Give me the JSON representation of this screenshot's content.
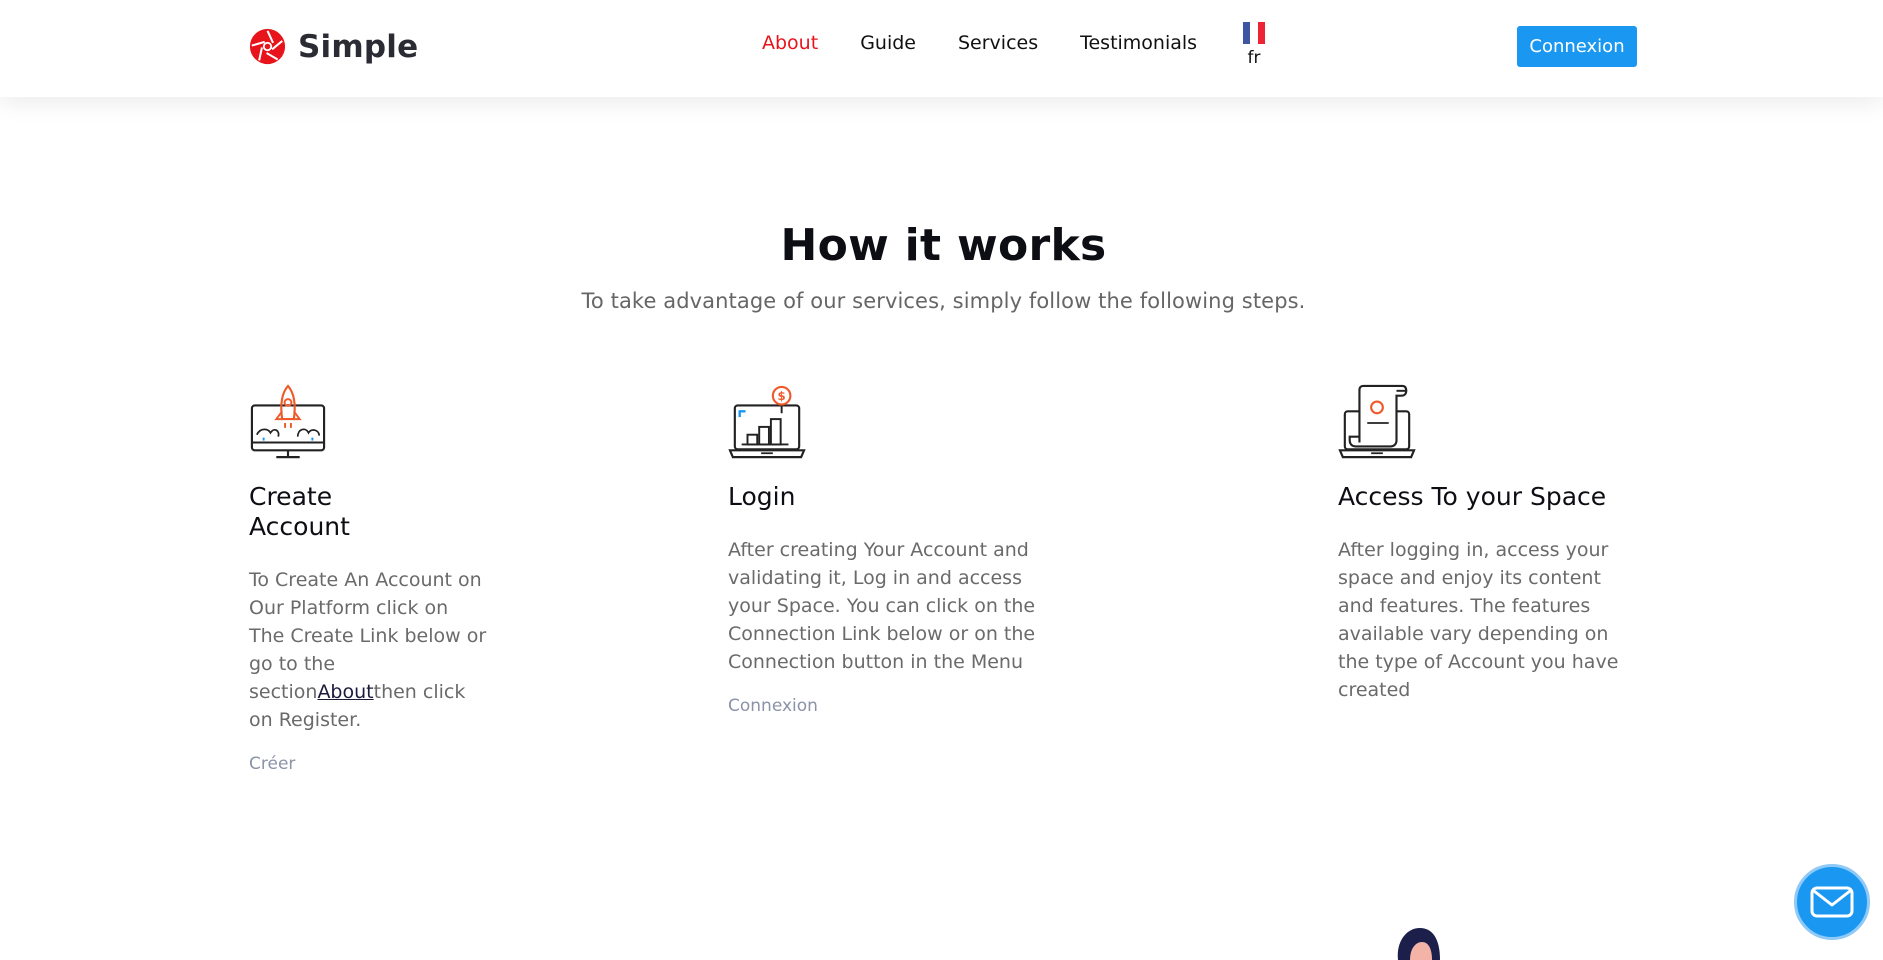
{
  "header": {
    "brand": "Simple",
    "nav": [
      {
        "label": "About",
        "active": true
      },
      {
        "label": "Guide",
        "active": false
      },
      {
        "label": "Services",
        "active": false
      },
      {
        "label": "Testimonials",
        "active": false
      }
    ],
    "language": {
      "code": "fr",
      "flag_colors": [
        "#3e55a2",
        "#ffffff",
        "#ee2436"
      ]
    },
    "connect_label": "Connexion"
  },
  "colors": {
    "accent": "#1a97f1",
    "active_nav": "#e8141b",
    "icon_accent": "#f05a2b"
  },
  "how_it_works": {
    "title": "How it works",
    "subtitle": "To take advantage of our services, simply follow the following steps.",
    "steps": [
      {
        "icon": "rocket-monitor-icon",
        "title": "Create Account",
        "text_before": "To Create An Account on Our Platform click on The Create Link below or go to the section",
        "inline_link": "About",
        "text_after": "then click on Register.",
        "link": "Créer"
      },
      {
        "icon": "laptop-growth-icon",
        "title": "Login",
        "text": "After creating Your Account and validating it, Log in and access your Space. You can click on the Connection Link below or on the Connection button in the Menu",
        "link": "Connexion"
      },
      {
        "icon": "laptop-document-icon",
        "title": "Access To your Space",
        "text": "After logging in, access your space and enjoy its content and features. The features available vary depending on the type of Account you have created"
      }
    ]
  },
  "floating": {
    "icon": "mail-icon"
  }
}
